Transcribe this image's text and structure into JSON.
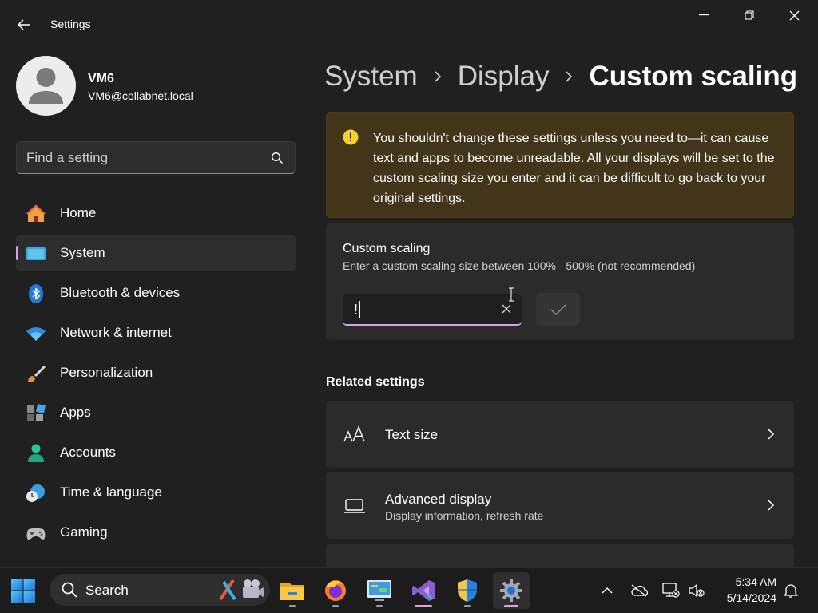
{
  "window": {
    "title": "Settings",
    "icons": {
      "back": "back-arrow-icon",
      "minimize": "minimize-icon",
      "maximize": "restore-icon",
      "close": "close-icon"
    }
  },
  "profile": {
    "name": "VM6",
    "email": "VM6@collabnet.local"
  },
  "search": {
    "placeholder": "Find a setting"
  },
  "nav": [
    {
      "label": "Home",
      "icon": "home-icon"
    },
    {
      "label": "System",
      "icon": "system-icon",
      "active": true
    },
    {
      "label": "Bluetooth & devices",
      "icon": "bluetooth-icon"
    },
    {
      "label": "Network & internet",
      "icon": "wifi-icon"
    },
    {
      "label": "Personalization",
      "icon": "brush-icon"
    },
    {
      "label": "Apps",
      "icon": "apps-icon"
    },
    {
      "label": "Accounts",
      "icon": "accounts-icon"
    },
    {
      "label": "Time & language",
      "icon": "time-language-icon"
    },
    {
      "label": "Gaming",
      "icon": "gaming-icon"
    }
  ],
  "breadcrumb": [
    "System",
    "Display",
    "Custom scaling"
  ],
  "warning": {
    "text": "You shouldn't change these settings unless you need to—it can cause text and apps to become unreadable. All your displays will be set to the custom scaling size you enter and it can be difficult to go back to your original settings."
  },
  "custom_scaling": {
    "title": "Custom scaling",
    "description": "Enter a custom scaling size between 100% - 500% (not recommended)",
    "value": "!"
  },
  "related": {
    "title": "Related settings",
    "items": [
      {
        "label": "Text size",
        "icon": "text-size-icon"
      },
      {
        "label": "Advanced display",
        "sub": "Display information, refresh rate",
        "icon": "monitor-icon"
      }
    ]
  },
  "taskbar": {
    "search_label": "Search",
    "apps": [
      "file-explorer-icon",
      "firefox-icon",
      "control-panel-icon",
      "visual-studio-icon",
      "security-shield-icon",
      "settings-gear-icon"
    ],
    "time": "5:34 AM",
    "date": "5/14/2024"
  },
  "colors": {
    "accent": "#d8a2e8",
    "warning_bg": "#433519",
    "warning_icon": "#f6d22e",
    "card_bg": "#2b2b2b",
    "window_bg": "#202020"
  }
}
